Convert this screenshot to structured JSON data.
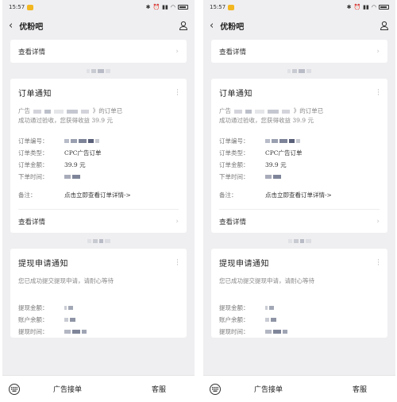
{
  "status_bar": {
    "time": "15:57"
  },
  "header": {
    "title": "优粉吧"
  },
  "detail_link": "查看详情",
  "order_card": {
    "title": "订单通知",
    "message_prefix": "广告",
    "message_mid": "》的订单已",
    "message_line2": "成功通过验收，您获得收益 39.9 元",
    "fields": [
      {
        "label": "订单编号：",
        "value": ""
      },
      {
        "label": "订单类型：",
        "value": "CPC广告订单"
      },
      {
        "label": "订单金额：",
        "value": "39.9 元"
      },
      {
        "label": "下单时间：",
        "value": ""
      }
    ],
    "remark_label": "备注：",
    "remark_value": "点击立即查看订单详情->",
    "detail_label": "查看详情"
  },
  "withdraw_card": {
    "title": "提现申请通知",
    "message": "您已成功提交提现申请，请耐心等待",
    "fields": [
      {
        "label": "提现金额：",
        "value": ""
      },
      {
        "label": "账户余额：",
        "value": ""
      },
      {
        "label": "提现时间：",
        "value": ""
      }
    ]
  },
  "tab_bar": {
    "tab1": "广告接单",
    "tab2": "客服"
  },
  "icons": [
    "back-arrow-icon",
    "person-icon",
    "chevron-right-icon",
    "more-vertical-icon",
    "keyboard-icon"
  ]
}
